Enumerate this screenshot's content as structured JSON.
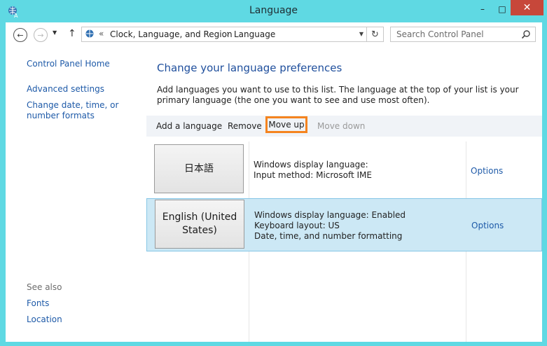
{
  "window": {
    "title": "Language"
  },
  "titlebar": {
    "minimize": "–",
    "maximize": "□",
    "close": "✕"
  },
  "address": {
    "crumb_prefix": "«",
    "crumbs": [
      "Clock, Language, and Region",
      "Language"
    ],
    "crumb_sep": "›"
  },
  "search": {
    "placeholder": "Search Control Panel"
  },
  "sidebar": {
    "home": "Control Panel Home",
    "advanced": "Advanced settings",
    "date": "Change date, time, or number formats",
    "see_also": "See also",
    "fonts": "Fonts",
    "location": "Location"
  },
  "main": {
    "heading": "Change your language preferences",
    "description": "Add languages you want to use to this list. The language at the top of your list is your primary language (the one you want to see and use most often).",
    "toolbar": {
      "add": "Add a language",
      "remove": "Remove",
      "move_up": "Move up",
      "move_down": "Move down"
    },
    "languages": [
      {
        "name": "日本語",
        "details": [
          "Windows display language:",
          "Input method: Microsoft IME"
        ],
        "options": "Options"
      },
      {
        "name": "English (United States)",
        "details": [
          "Windows display language: Enabled",
          "Keyboard layout: US",
          "Date, time, and number formatting"
        ],
        "options": "Options"
      }
    ]
  },
  "colors": {
    "title_bar": "#5fd9e3",
    "close_button": "#c7473a",
    "link": "#1e5aa8",
    "heading": "#1e4e9c",
    "highlight_box": "#f5841f",
    "selected_row": "#cce8f5"
  }
}
